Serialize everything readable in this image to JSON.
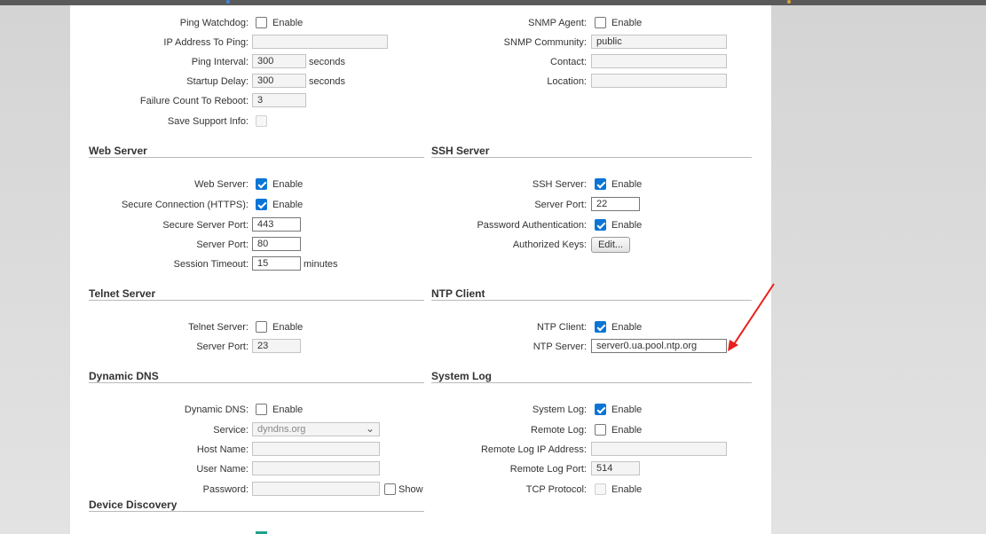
{
  "colors": {
    "accent": "#0b75d6",
    "arrow": "#e8201c"
  },
  "general": {
    "ping_watchdog_label": "Ping Watchdog:",
    "ping_watchdog_option": "Enable",
    "ip_to_ping_label": "IP Address To Ping:",
    "ip_to_ping_value": "",
    "ping_interval_label": "Ping Interval:",
    "ping_interval_value": "300",
    "ping_interval_unit": "seconds",
    "startup_delay_label": "Startup Delay:",
    "startup_delay_value": "300",
    "startup_delay_unit": "seconds",
    "failure_count_label": "Failure Count To Reboot:",
    "failure_count_value": "3",
    "save_support_label": "Save Support Info:",
    "snmp_agent_label": "SNMP Agent:",
    "snmp_agent_option": "Enable",
    "snmp_community_label": "SNMP Community:",
    "snmp_community_value": "public",
    "contact_label": "Contact:",
    "contact_value": "",
    "location_label": "Location:",
    "location_value": ""
  },
  "web_server": {
    "title": "Web Server",
    "web_server_label": "Web Server:",
    "web_server_option": "Enable",
    "https_label": "Secure Connection (HTTPS):",
    "https_option": "Enable",
    "secure_port_label": "Secure Server Port:",
    "secure_port_value": "443",
    "server_port_label": "Server Port:",
    "server_port_value": "80",
    "session_timeout_label": "Session Timeout:",
    "session_timeout_value": "15",
    "session_timeout_unit": "minutes"
  },
  "ssh_server": {
    "title": "SSH Server",
    "ssh_label": "SSH Server:",
    "ssh_option": "Enable",
    "port_label": "Server Port:",
    "port_value": "22",
    "password_auth_label": "Password Authentication:",
    "password_auth_option": "Enable",
    "keys_label": "Authorized Keys:",
    "keys_button": "Edit..."
  },
  "telnet_server": {
    "title": "Telnet Server",
    "telnet_label": "Telnet Server:",
    "telnet_option": "Enable",
    "port_label": "Server Port:",
    "port_value": "23"
  },
  "ntp_client": {
    "title": "NTP Client",
    "ntp_label": "NTP Client:",
    "ntp_option": "Enable",
    "server_label": "NTP Server:",
    "server_value": "server0.ua.pool.ntp.org"
  },
  "dynamic_dns": {
    "title": "Dynamic DNS",
    "ddns_label": "Dynamic DNS:",
    "ddns_option": "Enable",
    "service_label": "Service:",
    "service_value": "dyndns.org",
    "host_label": "Host Name:",
    "host_value": "",
    "user_label": "User Name:",
    "user_value": "",
    "password_label": "Password:",
    "password_value": "",
    "show_option": "Show"
  },
  "system_log": {
    "title": "System Log",
    "syslog_label": "System Log:",
    "syslog_option": "Enable",
    "remote_label": "Remote Log:",
    "remote_option": "Enable",
    "remote_ip_label": "Remote Log IP Address:",
    "remote_ip_value": "",
    "remote_port_label": "Remote Log Port:",
    "remote_port_value": "514",
    "tcp_label": "TCP Protocol:",
    "tcp_option": "Enable"
  },
  "device_discovery": {
    "title": "Device Discovery"
  }
}
